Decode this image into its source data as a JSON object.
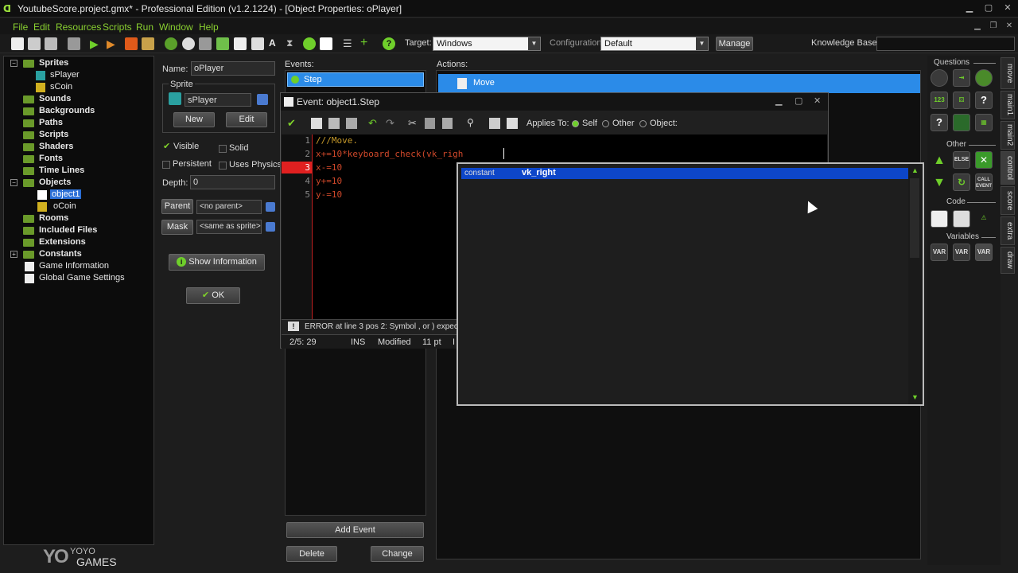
{
  "window": {
    "title": "YoutubeScore.project.gmx*  -  Professional Edition (v1.2.1224) - [Object Properties: oPlayer]"
  },
  "menu": [
    "File",
    "Edit",
    "Resources",
    "Scripts",
    "Run",
    "Window",
    "Help"
  ],
  "toolbar": {
    "target_label": "Target:",
    "target_value": "Windows",
    "config_label": "Configuration:",
    "config_value": "Default",
    "manage_label": "Manage",
    "kb_label": "Knowledge Base:"
  },
  "tree": {
    "sprites": "Sprites",
    "sprite_items": [
      "sPlayer",
      "sCoin"
    ],
    "sounds": "Sounds",
    "backgrounds": "Backgrounds",
    "paths": "Paths",
    "scripts": "Scripts",
    "shaders": "Shaders",
    "fonts": "Fonts",
    "timelines": "Time Lines",
    "objects": "Objects",
    "object_items": [
      "object1",
      "oCoin"
    ],
    "rooms": "Rooms",
    "included": "Included Files",
    "extensions": "Extensions",
    "constants": "Constants",
    "game_info": "Game Information",
    "global_settings": "Global Game Settings"
  },
  "logo": {
    "mark": "YO",
    "top": "YOYO",
    "bottom": "GAMES"
  },
  "object": {
    "name_label": "Name:",
    "name_value": "oPlayer",
    "sprite_group": "Sprite",
    "sprite_value": "sPlayer",
    "new_label": "New",
    "edit_label": "Edit",
    "visible": "Visible",
    "solid": "Solid",
    "persistent": "Persistent",
    "uses_physics": "Uses Physics",
    "depth_label": "Depth:",
    "depth_value": "0",
    "parent_label": "Parent",
    "parent_value": "<no parent>",
    "mask_label": "Mask",
    "mask_value": "<same as sprite>",
    "show_info": "Show Information",
    "ok": "OK"
  },
  "events": {
    "label": "Events:",
    "items": [
      "Step"
    ],
    "add_event": "Add Event",
    "delete": "Delete",
    "change": "Change"
  },
  "actions": {
    "label": "Actions:",
    "items": [
      "Move"
    ]
  },
  "event_window": {
    "title": "Event: object1.Step",
    "applies_to": "Applies To:",
    "self": "Self",
    "other": "Other",
    "object": "Object:",
    "line_numbers": [
      "1",
      "2",
      "3",
      "4",
      "5"
    ],
    "lines": [
      "///Move.",
      "x+=10*keyboard_check(vk_righ",
      "x-=10",
      "y+=10",
      "y-=10"
    ],
    "error": "ERROR at line 3 pos 2: Symbol , or ) expec",
    "status_pos": "2/5: 29",
    "status_ins": "INS",
    "status_modified": "Modified",
    "status_size": "11 pt",
    "status_more": "I"
  },
  "autocomplete": {
    "kind": "constant",
    "value": "vk_right"
  },
  "palette": {
    "questions": "Questions",
    "other": "Other",
    "code": "Code",
    "variables": "Variables",
    "else_label": "ELSE",
    "call_event_label": "CALL EVENT",
    "var_label": "VAR",
    "tabs": [
      "move",
      "main1",
      "main2",
      "control",
      "score",
      "extra",
      "draw"
    ]
  },
  "colors": {
    "accent_green": "#8ad130",
    "selection_blue": "#2b8be8",
    "error_red": "#e02020",
    "autocomplete_sel": "#0d46c9"
  }
}
